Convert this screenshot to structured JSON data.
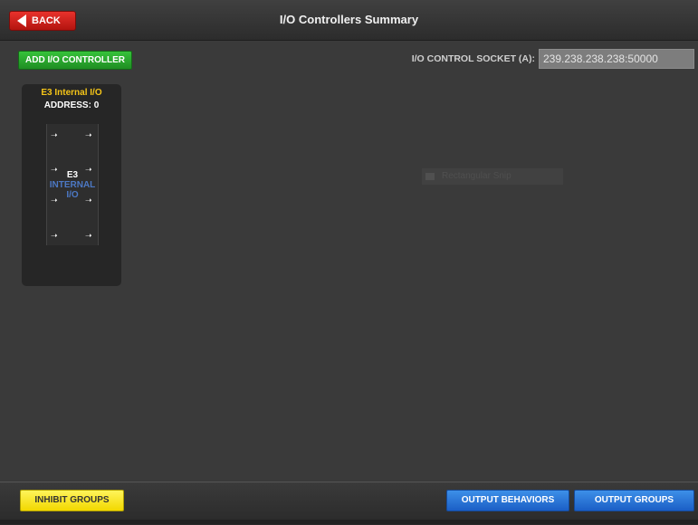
{
  "header": {
    "back_label": "BACK",
    "title": "I/O Controllers Summary",
    "back_icon": "arrow-left-icon"
  },
  "toolbar": {
    "add_label": "ADD I/O CONTROLLER",
    "socket_label": "I/O CONTROL SOCKET (A):",
    "socket_value": "239.238.238.238:50000"
  },
  "controller": {
    "name": "E3 Internal I/O",
    "address": "ADDRESS: 0",
    "chip_line1": "E3",
    "chip_line2": "INTERNAL",
    "chip_line3": "I/O",
    "pin_icon": "arrow-right-icon"
  },
  "ghost": {
    "text": "Rectangular Snip"
  },
  "footer": {
    "inhibit_label": "INHIBIT GROUPS",
    "behaviors_label": "OUTPUT BEHAVIORS",
    "groups_label": "OUTPUT GROUPS"
  },
  "colors": {
    "background": "#3a3a3a",
    "back_button": "#d42a24",
    "add_button": "#2fb333",
    "inhibit_button": "#f7e52c",
    "output_buttons": "#2a75d6",
    "controller_name": "#f5c518",
    "chip_internal": "#4c78c4"
  }
}
